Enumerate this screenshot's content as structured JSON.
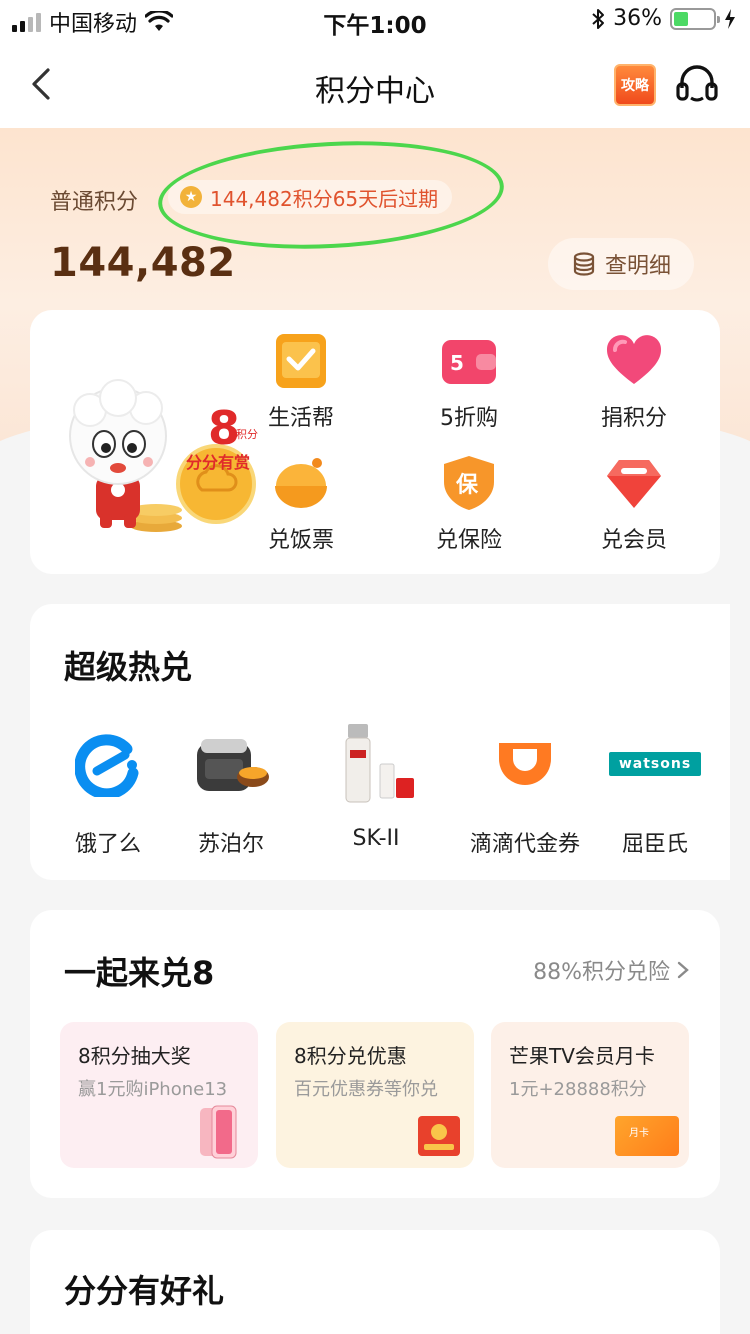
{
  "status_bar": {
    "carrier": "中国移动",
    "time": "下午1:00",
    "battery": "36%",
    "battery_level": 0.36
  },
  "nav": {
    "title": "积分中心",
    "strategy_badge": "攻略"
  },
  "points": {
    "label": "普通积分",
    "expire_notice": "144,482积分65天后过期",
    "value": "144,482",
    "detail_button": "查明细"
  },
  "mascot_badge": {
    "slogan": "分分有赏",
    "number": "8",
    "sub": "积分"
  },
  "services": [
    {
      "label": "生活帮",
      "icon": "checkmark-tablet-icon"
    },
    {
      "label": "5折购",
      "icon": "discount-wallet-icon"
    },
    {
      "label": "捐积分",
      "icon": "heart-icon"
    },
    {
      "label": "兑饭票",
      "icon": "rice-bowl-icon"
    },
    {
      "label": "兑保险",
      "icon": "insurance-shield-icon"
    },
    {
      "label": "兑会员",
      "icon": "member-diamond-icon"
    }
  ],
  "discount_badge": "5",
  "insurance_char": "保",
  "super_hot": {
    "title": "超级热兑",
    "brands": [
      {
        "label": "饿了么",
        "icon": "eleme-logo-icon"
      },
      {
        "label": "苏泊尔",
        "icon": "rice-cooker-icon"
      },
      {
        "label": "SK-II",
        "icon": "skincare-bottle-icon"
      },
      {
        "label": "滴滴代金券",
        "icon": "didi-logo-icon"
      },
      {
        "label": "屈臣氏",
        "icon": "watsons-logo-icon",
        "logo_text": "watsons"
      }
    ]
  },
  "exchange8": {
    "title": "一起来兑8",
    "link": "88%积分兑险",
    "tiles": [
      {
        "title": "8积分抽大奖",
        "subtitle": "赢1元购iPhone13",
        "bg": "#fdeef2"
      },
      {
        "title": "8积分兑优惠",
        "subtitle": "百元优惠券等你兑",
        "bg": "#fdf3e0"
      },
      {
        "title": "芒果TV会员月卡",
        "subtitle": "1元+28888积分",
        "bg": "#fdf0e8",
        "card_text": "月卡"
      }
    ]
  },
  "gifts": {
    "title": "分分有好礼"
  },
  "colors": {
    "accent_orange": "#f5821f",
    "points_brown": "#5a2f12",
    "annotation_green": "#4cd64c"
  }
}
